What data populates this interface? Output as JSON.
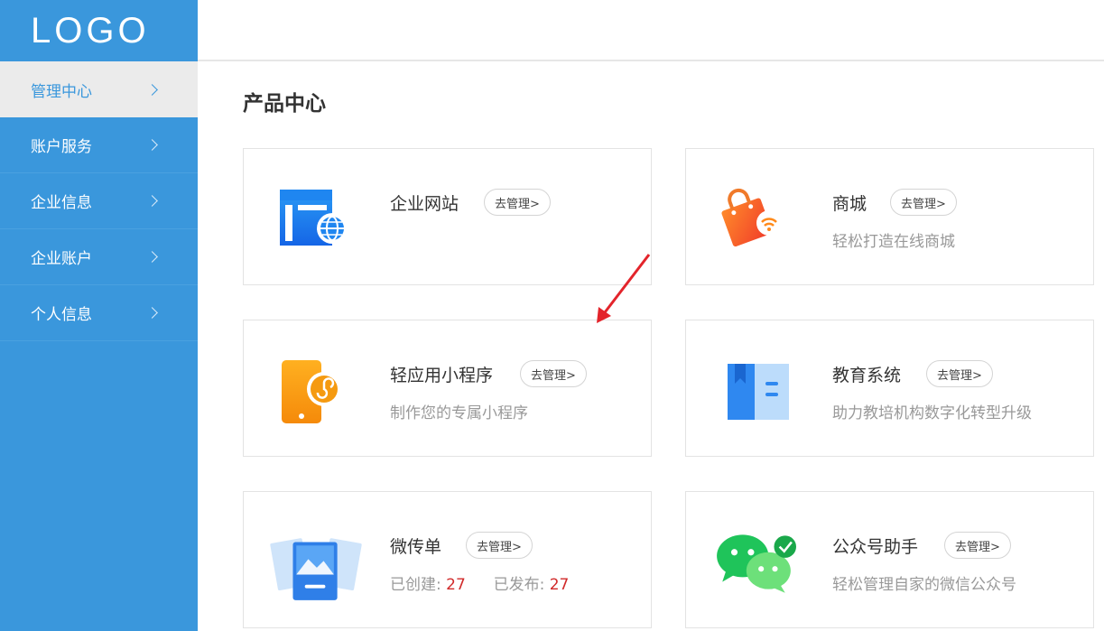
{
  "logo": "LOGO",
  "sidebar": {
    "items": [
      {
        "label": "管理中心"
      },
      {
        "label": "账户服务"
      },
      {
        "label": "企业信息"
      },
      {
        "label": "企业账户"
      },
      {
        "label": "个人信息"
      }
    ]
  },
  "page_title": "产品中心",
  "cards": [
    {
      "title": "企业网站",
      "button": "去管理>",
      "icon": "website-icon"
    },
    {
      "title": "商城",
      "button": "去管理>",
      "desc": "轻松打造在线商城",
      "icon": "shopping-bag-icon"
    },
    {
      "title": "轻应用小程序",
      "button": "去管理>",
      "desc": "制作您的专属小程序",
      "icon": "mini-program-icon"
    },
    {
      "title": "教育系统",
      "button": "去管理>",
      "desc": "助力教培机构数字化转型升级",
      "icon": "book-icon"
    },
    {
      "title": "微传单",
      "button": "去管理>",
      "created_label": "已创建:",
      "created": "27",
      "published_label": "已发布:",
      "published": "27",
      "icon": "flyer-icon"
    },
    {
      "title": "公众号助手",
      "button": "去管理>",
      "desc": "轻松管理自家的微信公众号",
      "icon": "wechat-icon"
    }
  ],
  "colors": {
    "sidebar": "#3a97dc",
    "active_bg": "#ebebeb",
    "accent_red": "#d12a2a"
  }
}
